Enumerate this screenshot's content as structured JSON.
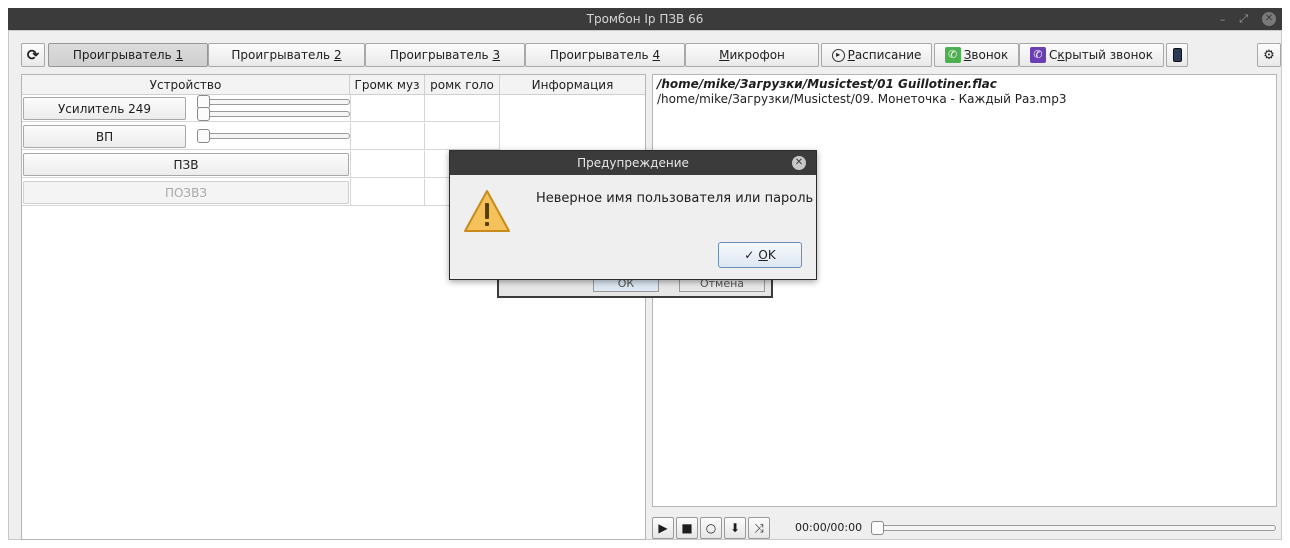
{
  "window": {
    "title": "Тромбон Ip ПЗВ 66"
  },
  "toolbar": {
    "refresh_icon": "refresh-icon",
    "tabs": [
      {
        "label_pre": "Проигрыватель ",
        "accel": "1"
      },
      {
        "label_pre": "Проигрыватель ",
        "accel": "2"
      },
      {
        "label_pre": "Проигрыватель ",
        "accel": "3"
      },
      {
        "label_pre": "Проигрыватель ",
        "accel": "4"
      }
    ],
    "mic": {
      "accel": "М",
      "rest": "икрофон"
    },
    "schedule": {
      "accel": "Р",
      "rest": "асписание"
    },
    "call": {
      "accel": "З",
      "rest": "вонок"
    },
    "hidden_call": {
      "pre": "С",
      "accel": "к",
      "rest": "рытый звонок"
    }
  },
  "devices": {
    "columns": [
      "Устройство",
      "Громк муз",
      "ромк голо",
      "Информация"
    ],
    "rows": [
      {
        "name": "Усилитель 249",
        "has_slider": true,
        "volume": 0
      },
      {
        "name": "ВП",
        "has_slider": true,
        "volume": 0
      },
      {
        "name": "ПЗВ",
        "has_slider": false
      },
      {
        "name": "ПОЗВЗ",
        "has_slider": false,
        "disabled": true
      }
    ]
  },
  "playlist": {
    "current": "/home/mike/Загрузки/Musictest/01 Guillotiner.flac",
    "other": "/home/mike/Загрузки/Musictest/09.  Монеточка  -  Каждый Раз.mp3"
  },
  "player": {
    "time": "00:00/00:00",
    "progress": 0
  },
  "background_dialog": {
    "ok": "ОК",
    "cancel": "Отмена"
  },
  "dialog": {
    "title": "Предупреждение",
    "message": "Неверное имя пользователя или пароль",
    "ok_accel": "O",
    "ok_rest": "K"
  }
}
